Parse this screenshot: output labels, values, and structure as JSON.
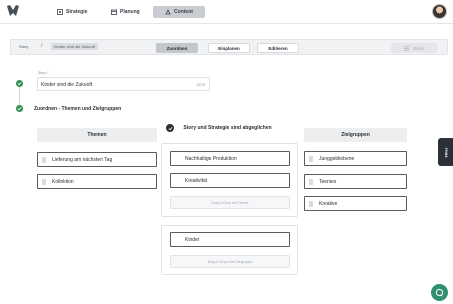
{
  "nav": {
    "tabs": [
      {
        "label": "Strategie",
        "icon": "strategy-icon"
      },
      {
        "label": "Planung",
        "icon": "calendar-icon"
      },
      {
        "label": "Content",
        "icon": "content-icon"
      }
    ],
    "active_tab": "Content"
  },
  "subbar": {
    "breadcrumb": [
      "Story",
      "/",
      "Kinder sind die Zukunft"
    ],
    "buttons": {
      "assign": "Zuordnen",
      "schedule": "Einplanen",
      "edit": "Editieren"
    },
    "story_button": "Story"
  },
  "story": {
    "label": "Story *",
    "value": "Kinder sind die Zukunft",
    "char_count": "23/75"
  },
  "section": {
    "title": "Zuordnen - Themen und Zielgruppen"
  },
  "columns": {
    "themes": {
      "title": "Themen",
      "items": [
        "Lieferung am nächsten Tag",
        "Kollektion"
      ]
    },
    "middle": {
      "title": "Story und Strategie sind abgeglichen",
      "themes_items": [
        "Nachhaltige Produktion",
        "Kreativität"
      ],
      "themes_drop": "Drag & Drop ein Theme",
      "audience_items": [
        "Kinder"
      ],
      "audience_drop": "Drag & Drop eine Zielgruppe"
    },
    "audiences": {
      "title": "Zielgruppen",
      "items": [
        "Junggebliebene",
        "Teenies",
        "Kreative"
      ]
    }
  },
  "filter_tab": {
    "label": "Filter"
  },
  "colors": {
    "accent_green": "#2f8f4e",
    "dark": "#2b3038",
    "chat": "#2f8f6e"
  }
}
